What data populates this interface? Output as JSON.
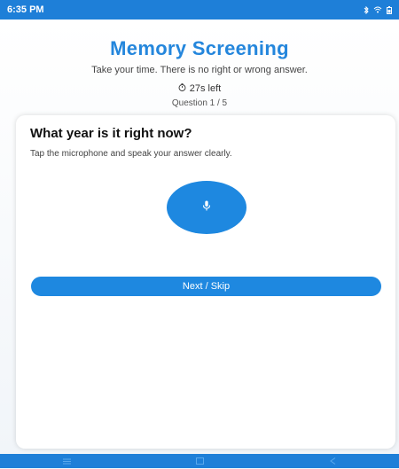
{
  "status_bar": {
    "time": "6:35 PM",
    "icons": [
      "bluetooth-icon",
      "wifi-icon",
      "battery-icon"
    ]
  },
  "header": {
    "title": "Memory Screening",
    "subtitle": "Take your time. There is no right or wrong answer.",
    "timer_text": "27s left",
    "question_counter": "Question 1 / 5"
  },
  "card": {
    "question": "What year is it right now?",
    "instruction": "Tap the microphone and speak your answer clearly.",
    "mic_icon": "microphone-icon",
    "next_label": "Next / Skip"
  },
  "nav_bar": {
    "icons": [
      "menu-icon",
      "home-icon",
      "back-icon"
    ]
  },
  "colors": {
    "accent": "#1e88e0",
    "title": "#2486dc",
    "status_bar": "#1e7fd8"
  }
}
